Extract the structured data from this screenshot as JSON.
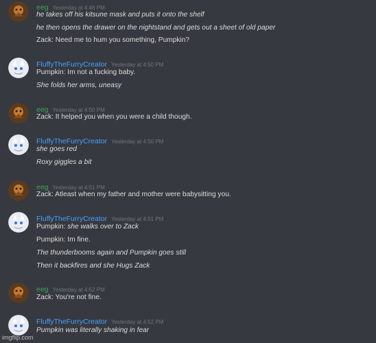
{
  "colors": {
    "background": "#36393f",
    "text": "#dcddde",
    "timestamp": "#72767d",
    "eeg_username": "#3ba55c",
    "fluffy_username": "#4aa0ff"
  },
  "messages": [
    {
      "author": "eeg",
      "timestamp": "Yesterday at 4:46 PM",
      "lines": [
        {
          "text": "he takes off his kitsune mask and puts it onto the shelf",
          "italic": true
        },
        {
          "text": "he then opens the drawer on the nightstand and gets out a sheet of old paper",
          "italic": true
        },
        {
          "text": "Zack: Need me to hum you something, Pumpkin?",
          "italic": false
        }
      ]
    },
    {
      "author": "FluffyTheFurryCreator",
      "timestamp": "Yesterday at 4:50 PM",
      "lines": [
        {
          "text": "Pumpkin: Im not a fucking baby.",
          "italic": false
        },
        {
          "text": "She folds her arms, uneasy",
          "italic": true
        }
      ]
    },
    {
      "author": "eeg",
      "timestamp": "Yesterday at 4:50 PM",
      "lines": [
        {
          "text": "Zack: It helped you when you were a child though.",
          "italic": false
        }
      ]
    },
    {
      "author": "FluffyTheFurryCreator",
      "timestamp": "Yesterday at 4:50 PM",
      "lines": [
        {
          "text": "she goes red",
          "italic": true
        },
        {
          "text": "Roxy giggles a bit",
          "italic": true
        }
      ]
    },
    {
      "author": "eeg",
      "timestamp": "Yesterday at 4:51 PM",
      "lines": [
        {
          "text": "Zack: Atleast when my father and mother were babysitting you.",
          "italic": false
        }
      ]
    },
    {
      "author": "FluffyTheFurryCreator",
      "timestamp": "Yesterday at 4:51 PM",
      "lines": [
        {
          "text": "Pumpkin: she walks over to Zack",
          "italic": false,
          "italic_tail": "she walks over to Zack",
          "prefix": "Pumpkin: "
        },
        {
          "text": "Pumpkin: Im fine.",
          "italic": false
        },
        {
          "text": "The thunderbooms again and Pumpkin goes still",
          "italic": true
        },
        {
          "text": "Then it backfires and she Hugs Zack",
          "italic": true
        }
      ]
    },
    {
      "author": "eeg",
      "timestamp": "Yesterday at 4:52 PM",
      "lines": [
        {
          "text": "Zack: You're not fine.",
          "italic": false
        }
      ]
    },
    {
      "author": "FluffyTheFurryCreator",
      "timestamp": "Yesterday at 4:52 PM",
      "lines": [
        {
          "text": "Pumpkin was literally shaking in fear",
          "italic": true
        }
      ]
    }
  ],
  "watermark": "imgflip.com"
}
